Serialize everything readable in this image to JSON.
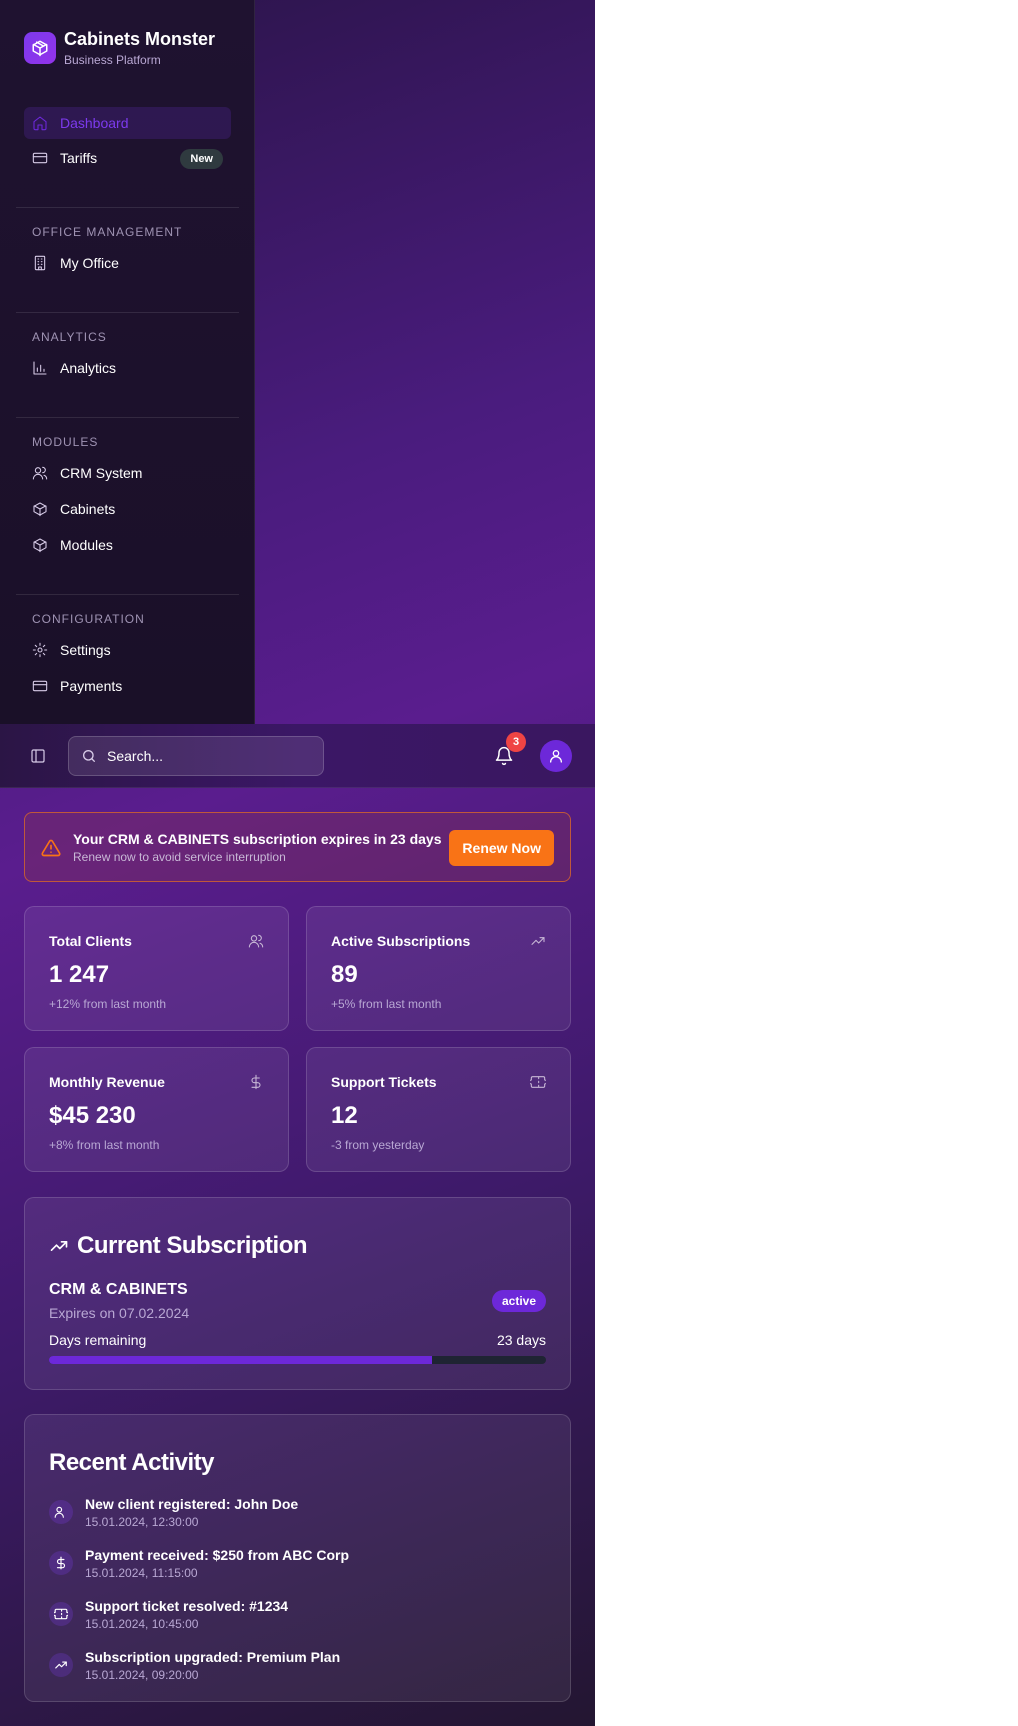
{
  "brand": {
    "name": "Cabinets Monster",
    "subtitle": "Business Platform"
  },
  "sidebar": {
    "items": [
      {
        "label": "Dashboard",
        "icon": "home-icon",
        "active": true
      },
      {
        "label": "Tariffs",
        "icon": "card-icon",
        "badge": "New"
      }
    ],
    "sections": [
      {
        "title": "OFFICE MANAGEMENT",
        "items": [
          {
            "label": "My Office",
            "icon": "building-icon"
          }
        ]
      },
      {
        "title": "ANALYTICS",
        "items": [
          {
            "label": "Analytics",
            "icon": "bar-chart-icon"
          }
        ]
      },
      {
        "title": "MODULES",
        "items": [
          {
            "label": "CRM System",
            "icon": "users-icon"
          },
          {
            "label": "Cabinets",
            "icon": "box-icon"
          },
          {
            "label": "Modules",
            "icon": "box-icon"
          }
        ]
      },
      {
        "title": "CONFIGURATION",
        "items": [
          {
            "label": "Settings",
            "icon": "gear-icon"
          },
          {
            "label": "Payments",
            "icon": "card-icon"
          }
        ]
      }
    ]
  },
  "topbar": {
    "search_placeholder": "Search...",
    "notifications_count": "3"
  },
  "alert": {
    "title": "Your CRM & CABINETS subscription expires in 23 days",
    "subtitle": "Renew now to avoid service interruption",
    "button": "Renew Now",
    "color": "#f97316"
  },
  "stats": [
    {
      "title": "Total Clients",
      "value": "1 247",
      "delta": "+12% from last month",
      "icon": "users-icon"
    },
    {
      "title": "Active Subscriptions",
      "value": "89",
      "delta": "+5% from last month",
      "icon": "trending-up-icon"
    },
    {
      "title": "Monthly Revenue",
      "value": "$45 230",
      "delta": "+8% from last month",
      "icon": "dollar-icon"
    },
    {
      "title": "Support Tickets",
      "value": "12",
      "delta": "-3 from yesterday",
      "icon": "ticket-icon"
    }
  ],
  "subscription": {
    "title": "Current Subscription",
    "plan": "CRM & CABINETS",
    "expires": "Expires on 07.02.2024",
    "status": "active",
    "days_label": "Days remaining",
    "days_value": "23 days",
    "progress_fraction": 0.77,
    "accent": "#6d28d9"
  },
  "activity": {
    "title": "Recent Activity",
    "items": [
      {
        "text": "New client registered: John Doe",
        "time": "15.01.2024, 12:30:00",
        "icon": "user-icon"
      },
      {
        "text": "Payment received: $250 from ABC Corp",
        "time": "15.01.2024, 11:15:00",
        "icon": "dollar-icon"
      },
      {
        "text": "Support ticket resolved: #1234",
        "time": "15.01.2024, 10:45:00",
        "icon": "ticket-icon"
      },
      {
        "text": "Subscription upgraded: Premium Plan",
        "time": "15.01.2024, 09:20:00",
        "icon": "trending-up-icon"
      }
    ]
  }
}
